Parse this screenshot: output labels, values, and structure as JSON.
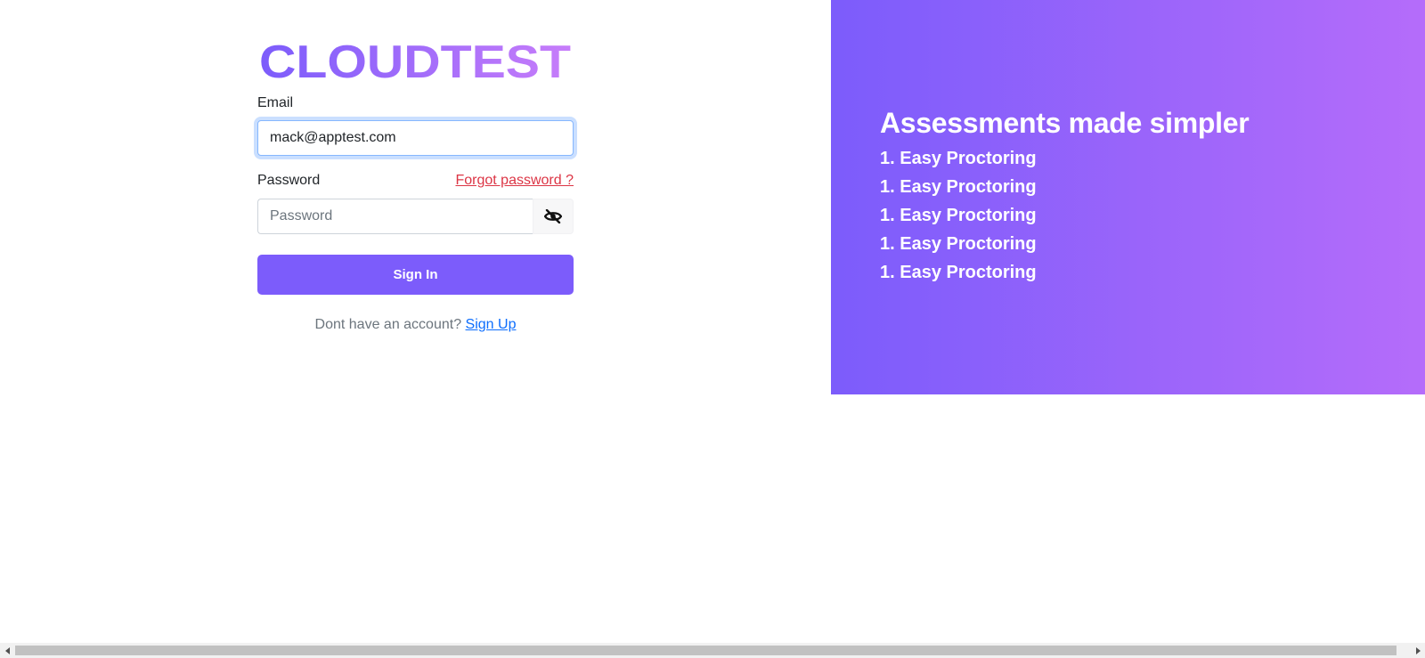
{
  "brand": {
    "logo_text": "CLOUDTEST",
    "gradient_start": "#7c5cfb",
    "gradient_end": "#c77dfa"
  },
  "login": {
    "email_label": "Email",
    "email_value": "mack@apptest.com",
    "password_label": "Password",
    "forgot_label": "Forgot password ?",
    "password_placeholder": "Password",
    "password_value": "",
    "toggle_icon": "eye-slash-icon",
    "signin_label": "Sign In",
    "signup_prompt": "Dont have an account?",
    "signup_label": "Sign Up"
  },
  "promo": {
    "title": "Assessments made simpler",
    "items": [
      "1. Easy Proctoring",
      "1. Easy Proctoring",
      "1. Easy Proctoring",
      "1. Easy Proctoring",
      "1. Easy Proctoring"
    ]
  },
  "colors": {
    "accent": "#7c5cfb",
    "danger_link": "#dc3545",
    "link": "#0d6efd",
    "panel_start": "#7c5cfb",
    "panel_end": "#b56cfa"
  }
}
